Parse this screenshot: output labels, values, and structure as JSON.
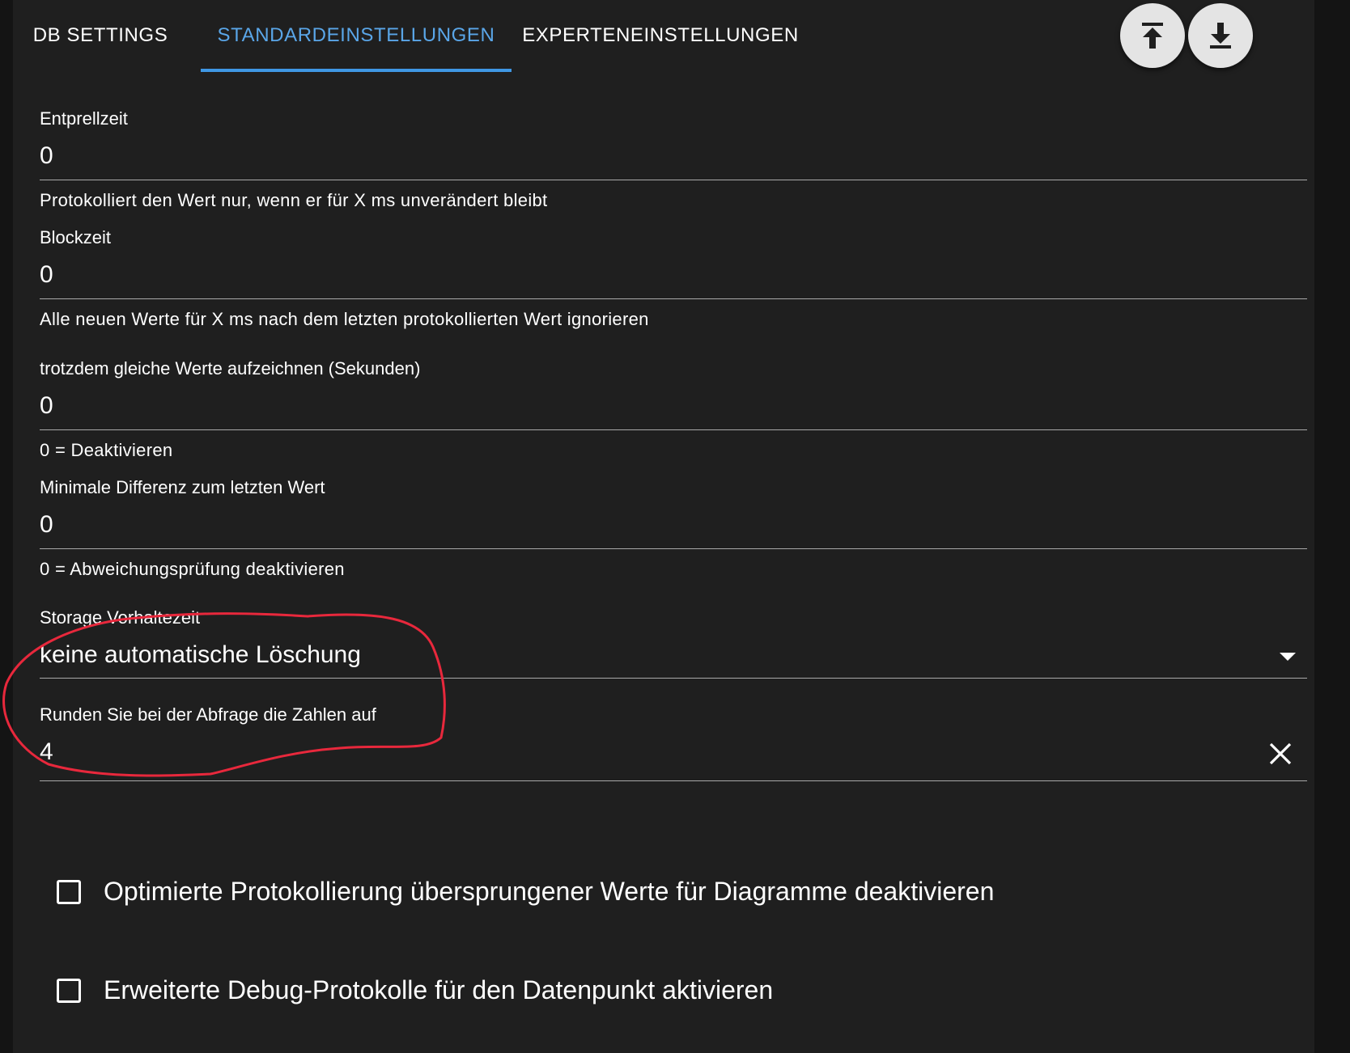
{
  "tabs": [
    {
      "label": "DB SETTINGS"
    },
    {
      "label": "STANDARDEINSTELLUNGEN"
    },
    {
      "label": "EXPERTENEINSTELLUNGEN"
    }
  ],
  "active_tab": "STANDARDEINSTELLUNGEN",
  "toolbar": {
    "upload_icon": "upload-to-top-icon",
    "download_icon": "download-icon"
  },
  "fields": {
    "debounce": {
      "label": "Entprellzeit",
      "value": "0",
      "help": "Protokolliert den Wert nur, wenn er für X ms unverändert bleibt"
    },
    "blocktime": {
      "label": "Blockzeit",
      "value": "0",
      "help": "Alle neuen Werte für X ms nach dem letzten protokollierten Wert ignorieren"
    },
    "changes_relog": {
      "label": "trotzdem gleiche Werte aufzeichnen (Sekunden)",
      "value": "0",
      "help": "0 = Deaktivieren"
    },
    "min_difference": {
      "label": "Minimale Differenz zum letzten Wert",
      "value": "0",
      "help": "0 = Abweichungsprüfung deaktivieren"
    },
    "storage_retention": {
      "label": "Storage Vorhaltezeit",
      "value": "keine automatische Löschung",
      "icon": "dropdown-arrow-icon"
    },
    "round": {
      "label": "Runden Sie bei der Abfrage die Zahlen auf",
      "value": "4",
      "icon": "clear-icon"
    }
  },
  "checkboxes": [
    {
      "label": "Optimierte Protokollierung übersprungener Werte für Diagramme deaktivieren",
      "checked": false
    },
    {
      "label": "Erweiterte Debug-Protokolle für den Datenpunkt aktivieren",
      "checked": false
    }
  ],
  "colors": {
    "background": "#1f1f1f",
    "accent": "#3f97e4",
    "annotation": "#e8283c"
  }
}
